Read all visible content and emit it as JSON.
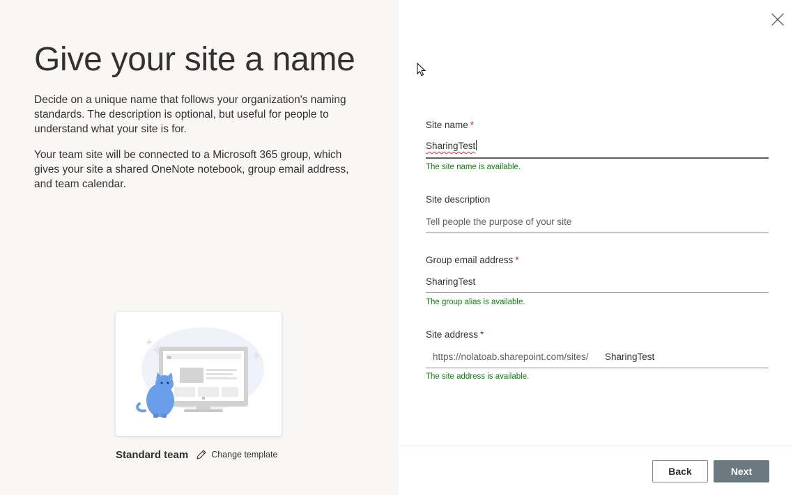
{
  "intro": {
    "title": "Give your site a name",
    "paragraph1": "Decide on a unique name that follows your organization's naming standards. The description is optional, but useful for people to understand what your site is for.",
    "paragraph2": "Your team site will be connected to a Microsoft 365 group, which gives your site a shared OneNote notebook, group email address, and team calendar."
  },
  "template": {
    "name": "Standard team",
    "change_label": "Change template"
  },
  "form": {
    "site_name": {
      "label": "Site name",
      "required_mark": "*",
      "value": "SharingTest",
      "hint": "The site name is available."
    },
    "site_description": {
      "label": "Site description",
      "value": "",
      "placeholder": "Tell people the purpose of your site"
    },
    "group_email": {
      "label": "Group email address",
      "required_mark": "*",
      "value": "SharingTest",
      "hint": "The group alias is available."
    },
    "site_address": {
      "label": "Site address",
      "required_mark": "*",
      "prefix": "https://nolatoab.sharepoint.com/sites/",
      "value": "SharingTest",
      "hint": "The site address is available."
    }
  },
  "footer": {
    "back_label": "Back",
    "next_label": "Next"
  },
  "icons": {
    "close": "close-icon",
    "edit": "pencil-icon",
    "cursor": "mouse-cursor-icon"
  },
  "colors": {
    "success": "#107c10",
    "required": "#a4262c",
    "next_button": "#69797e",
    "left_panel": "#f8f7f6",
    "illustration_blue": "#6a9ee8"
  }
}
